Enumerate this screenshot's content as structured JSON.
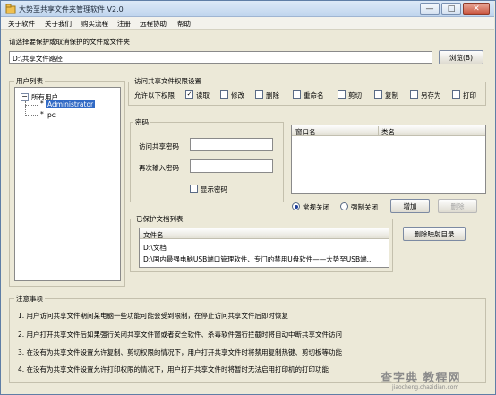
{
  "window": {
    "title": "大势至共享文件夹管理软件 V2.0",
    "min_label": "—",
    "max_label": "□",
    "close_label": "✕"
  },
  "menu": [
    "关于软件",
    "关于我们",
    "购买流程",
    "注册",
    "远程协助",
    "帮助"
  ],
  "folder_section": {
    "prompt": "请选择要保护或取消保护的文件或文件夹",
    "path_value": "D:\\共享文件路径",
    "browse_label": "浏览(B)"
  },
  "user_list": {
    "title": "用户列表",
    "root": "所有用户",
    "users": [
      "Administrator",
      "pc"
    ],
    "expander": "−",
    "user_marker": "*"
  },
  "permissions": {
    "title": "访问共享文件权限设置",
    "intro": "允许以下权限",
    "items": [
      {
        "label": "读取",
        "checked": true
      },
      {
        "label": "修改",
        "checked": false
      },
      {
        "label": "删除",
        "checked": false
      },
      {
        "label": "重命名",
        "checked": false
      },
      {
        "label": "剪切",
        "checked": false
      },
      {
        "label": "复制",
        "checked": false
      },
      {
        "label": "另存为",
        "checked": false
      },
      {
        "label": "打印",
        "checked": false
      }
    ]
  },
  "password": {
    "title": "密码",
    "access_label": "访问共享密码",
    "confirm_label": "再次输入密码",
    "show_label": "显示密码",
    "access_value": "",
    "confirm_value": ""
  },
  "process_table": {
    "columns": [
      "窗口名",
      "类名"
    ],
    "rows": []
  },
  "close_mode": {
    "options": [
      {
        "label": "常规关闭",
        "selected": true
      },
      {
        "label": "强制关闭",
        "selected": false
      }
    ],
    "add_label": "增加",
    "delete_label": "删除"
  },
  "protected_list": {
    "title": "已保护文档列表",
    "column": "文件名",
    "files": [
      "D:\\文档",
      "D:\\国内最强电脑USB端口管理软件、专门的禁用U盘软件——大势至USB端..."
    ],
    "remove_label": "删除映射目录"
  },
  "notes": {
    "title": "注意事项",
    "items": [
      "1. 用户访问共享文件期间某电脑一些功能可能会受到限制，在停止访问共享文件后即时恢复",
      "2. 用户打开共享文件后如果强行关闭共享文件窗或者安全软件、杀毒软件强行拦截时将自动中断共享文件访问",
      "3. 在没有为共享文件设置允许复制、剪切权限的情况下，用户打开共享文件时将禁用复制热键、剪切板等功能",
      "4. 在没有为共享文件设置允许打印权限的情况下，用户打开共享文件时将暂时无法启用打印机的打印功能"
    ]
  },
  "watermark": {
    "text": "查字典 教程网",
    "sub": "jiaocheng.chazidian.com"
  }
}
